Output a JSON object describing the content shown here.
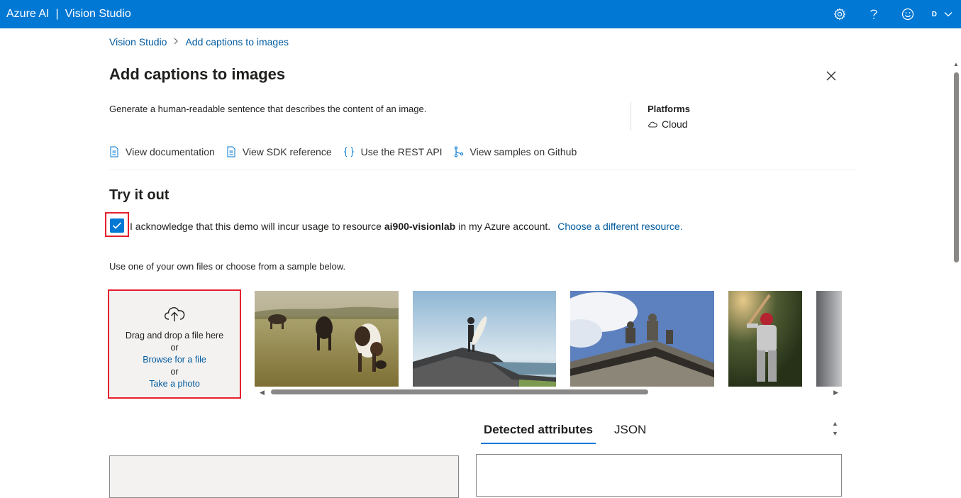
{
  "topbar": {
    "app_name": "Azure AI",
    "separator": "|",
    "product": "Vision Studio",
    "avatar_initial": "D",
    "icons": [
      "gear-icon",
      "help-icon",
      "smiley-icon",
      "chevron-down-icon"
    ]
  },
  "breadcrumb": {
    "root": "Vision Studio",
    "separator": ">",
    "current": "Add captions to images"
  },
  "page": {
    "title": "Add captions to images",
    "description": "Generate a human-readable sentence that describes the content of an image."
  },
  "platforms": {
    "title": "Platforms",
    "item": "Cloud"
  },
  "links": [
    {
      "label": "View documentation",
      "icon": "document-icon"
    },
    {
      "label": "View SDK reference",
      "icon": "document-icon"
    },
    {
      "label": "Use the REST API",
      "icon": "braces-icon"
    },
    {
      "label": "View samples on Github",
      "icon": "branch-icon"
    }
  ],
  "try_it": {
    "title": "Try it out",
    "ack_prefix": "I acknowledge that this demo will incur usage to resource",
    "resource": "ai900-visionlab",
    "ack_suffix": "in my Azure account.",
    "choose_link": "Choose a different resource.",
    "checked": true,
    "use_own": "Use one of your own files or choose from a sample below."
  },
  "dropzone": {
    "drag_text": "Drag and drop a file here",
    "or1": "or",
    "browse": "Browse for a file",
    "or2": "or",
    "take_photo": "Take a photo"
  },
  "samples": [
    "cows-in-field",
    "surfer-on-rock",
    "building-statues",
    "baseball-batter",
    "partial-gray"
  ],
  "tabs": {
    "detected": "Detected attributes",
    "json": "JSON",
    "active": "detected"
  },
  "colors": {
    "accent": "#0078d4",
    "highlight": "#e5202e",
    "link": "#005a9e"
  }
}
